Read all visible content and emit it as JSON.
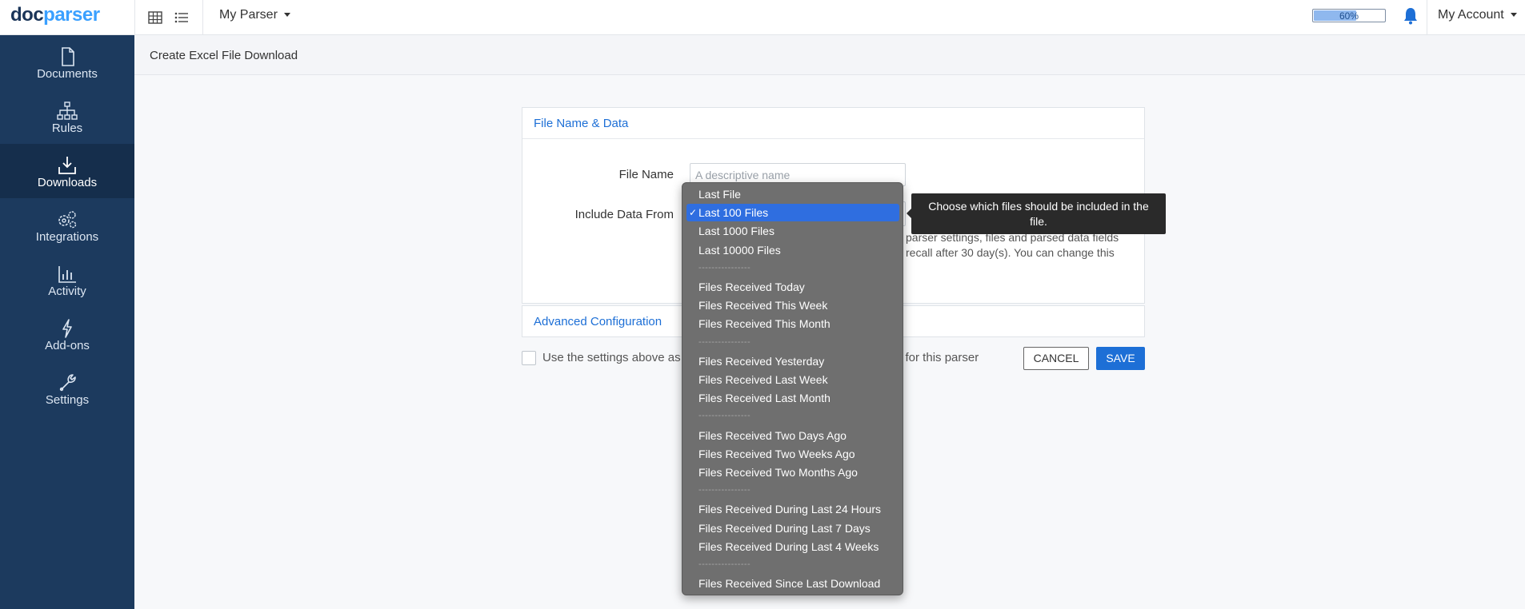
{
  "brand": {
    "part1": "doc",
    "part2": "parser"
  },
  "topbar": {
    "parser_name": "My Parser",
    "usage_label": "60%",
    "usage_fraction": 0.6,
    "account_label": "My Account",
    "icons": [
      "grid-view-icon",
      "list-view-icon",
      "bell-icon"
    ]
  },
  "sidebar": {
    "items": [
      {
        "label": "Documents",
        "icon": "document-icon",
        "active": false
      },
      {
        "label": "Rules",
        "icon": "rules-tree-icon",
        "active": false
      },
      {
        "label": "Downloads",
        "icon": "download-icon",
        "active": true
      },
      {
        "label": "Integrations",
        "icon": "gears-icon",
        "active": false
      },
      {
        "label": "Activity",
        "icon": "bar-chart-icon",
        "active": false
      },
      {
        "label": "Add-ons",
        "icon": "lightning-icon",
        "active": false
      },
      {
        "label": "Settings",
        "icon": "wrench-icon",
        "active": false
      }
    ]
  },
  "page": {
    "title": "Create Excel File Download"
  },
  "form": {
    "panel_title": "File Name & Data",
    "file_name_label": "File Name",
    "file_name_placeholder": "A descriptive name",
    "include_label": "Include Data From",
    "help_line1": "parser settings, files and parsed data fields",
    "help_line2": "recall after 30 day(s). You can change this",
    "advanced_title": "Advanced Configuration",
    "checkbox_label_part1": "Use the settings above as",
    "checkbox_label_part2": "n for this parser",
    "cancel_label": "CANCEL",
    "save_label": "SAVE"
  },
  "dropdown": {
    "check_mark": "✓",
    "separator": "----------------",
    "options": [
      "Last File",
      "Last 100 Files",
      "Last 1000 Files",
      "Last 10000 Files",
      "----------------",
      "Files Received Today",
      "Files Received This Week",
      "Files Received This Month",
      "----------------",
      "Files Received Yesterday",
      "Files Received Last Week",
      "Files Received Last Month",
      "----------------",
      "Files Received Two Days Ago",
      "Files Received Two Weeks Ago",
      "Files Received Two Months Ago",
      "----------------",
      "Files Received During Last 24 Hours",
      "Files Received During Last 7 Days",
      "Files Received During Last 4 Weeks",
      "----------------",
      "Files Received Since Last Download"
    ],
    "selected": "Last 100 Files"
  },
  "tooltip": {
    "text": "Choose which files should be included in the file."
  },
  "colors": {
    "sidebar": "#1c3a5e",
    "accent": "#1d6fd6",
    "dropdown_bg": "#6f6f6f",
    "selection": "#2f6ee0"
  }
}
